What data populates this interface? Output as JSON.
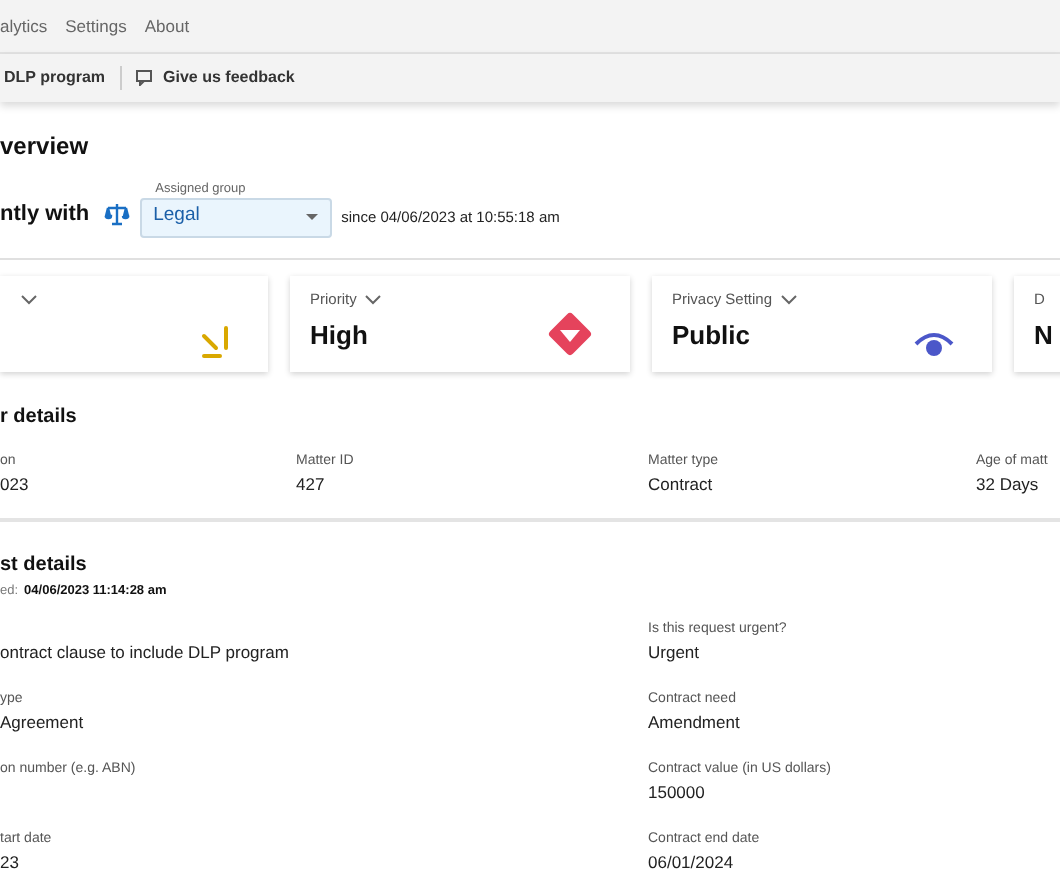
{
  "nav": {
    "items": [
      "alytics",
      "Settings",
      "About"
    ]
  },
  "toolbar": {
    "items": [
      {
        "kind": "plain",
        "label": "DLP program"
      },
      {
        "kind": "feedback",
        "label": "Give us feedback"
      }
    ]
  },
  "overview": {
    "title": "verview",
    "assignment": {
      "label": "ntly with",
      "field_label": "Assigned group",
      "value": "Legal",
      "since": "since 04/06/2023 at 10:55:18 am"
    }
  },
  "cards": [
    {
      "kind": "status"
    },
    {
      "kind": "priority",
      "label": "Priority",
      "value": "High"
    },
    {
      "kind": "privacy",
      "label": "Privacy Setting",
      "value": "Public"
    },
    {
      "kind": "other",
      "label": "D",
      "value": "N"
    }
  ],
  "matter_details": {
    "title": "r details",
    "fields": [
      {
        "label": "on",
        "value": "023"
      },
      {
        "label": "Matter ID",
        "value": "427"
      },
      {
        "label": "Matter type",
        "value": "Contract"
      },
      {
        "label": "Age of matt",
        "value": "32 Days"
      }
    ]
  },
  "request_details": {
    "title": "st details",
    "submitted_label": "ed:",
    "submitted_value": "04/06/2023 11:14:28 am",
    "rows": [
      [
        {
          "value": "ontract clause to include DLP program"
        },
        {
          "label": "Is this request urgent?",
          "value": "Urgent"
        }
      ],
      [
        {
          "label": "ype",
          "value": "Agreement"
        },
        {
          "label": "Contract need",
          "value": "Amendment"
        }
      ],
      [
        {
          "label": "on number (e.g. ABN)"
        },
        {
          "label": "Contract value (in US dollars)",
          "value": "150000"
        }
      ],
      [
        {
          "label": "tart date",
          "value": "23"
        },
        {
          "label": "Contract end date",
          "value": "06/01/2024"
        }
      ]
    ]
  }
}
